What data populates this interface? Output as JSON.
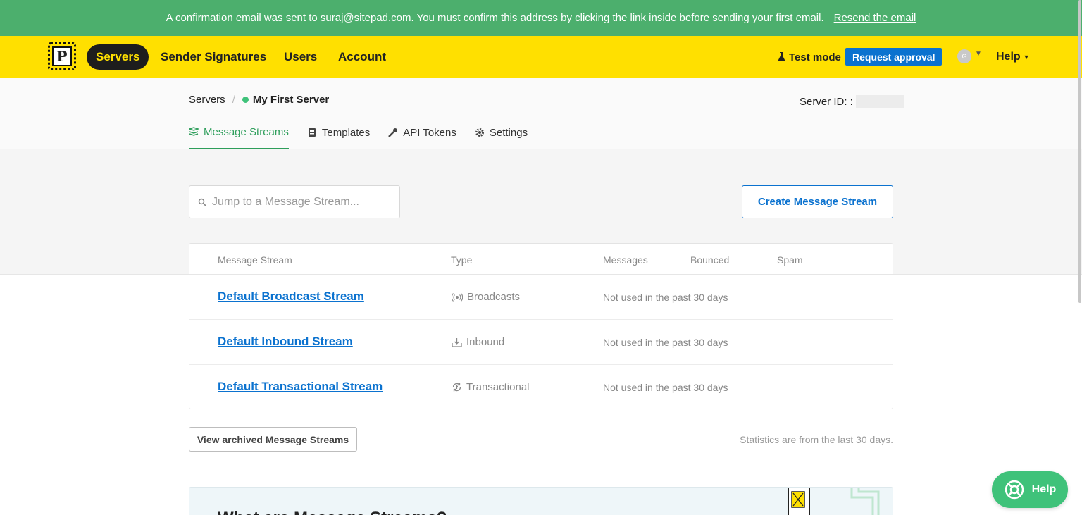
{
  "banner": {
    "message": "A confirmation email was sent to suraj@sitepad.com. You must confirm this address by clicking the link inside before sending your first email.",
    "link": "Resend the email"
  },
  "nav": {
    "logo_letter": "P",
    "items": [
      {
        "label": "Servers",
        "active": true
      },
      {
        "label": "Sender Signatures"
      },
      {
        "label": "Users"
      },
      {
        "label": "Account"
      }
    ],
    "test_mode": "Test mode",
    "request_approval": "Request approval",
    "avatar_initial": "G",
    "help": "Help"
  },
  "breadcrumb": {
    "root": "Servers",
    "separator": "/",
    "server_name": "My First Server"
  },
  "server_id_label": "Server ID: :",
  "tabs": [
    {
      "label": "Message Streams",
      "icon": "streams-icon",
      "active": true
    },
    {
      "label": "Templates",
      "icon": "templates-icon"
    },
    {
      "label": "API Tokens",
      "icon": "key-icon"
    },
    {
      "label": "Settings",
      "icon": "gear-icon"
    }
  ],
  "search": {
    "placeholder": "Jump to a Message Stream..."
  },
  "create_button": "Create Message Stream",
  "table": {
    "headers": [
      "Message Stream",
      "Type",
      "Messages",
      "Bounced",
      "Spam"
    ],
    "rows": [
      {
        "name": "Default Broadcast Stream",
        "type": "Broadcasts",
        "type_icon": "broadcast-icon",
        "messages": "Not used in the past 30 days"
      },
      {
        "name": "Default Inbound Stream",
        "type": "Inbound",
        "type_icon": "inbound-icon",
        "messages": "Not used in the past 30 days"
      },
      {
        "name": "Default Transactional Stream",
        "type": "Transactional",
        "type_icon": "transactional-icon",
        "messages": "Not used in the past 30 days"
      }
    ]
  },
  "archived_button": "View archived Message Streams",
  "stats_note": "Statistics are from the last 30 days.",
  "info_title": "What are Message Streams?",
  "help_float": "Help",
  "colors": {
    "banner": "#4caf6d",
    "nav": "#ffe000",
    "accent": "#0b72cf",
    "active_tab": "#2e9e5b"
  }
}
